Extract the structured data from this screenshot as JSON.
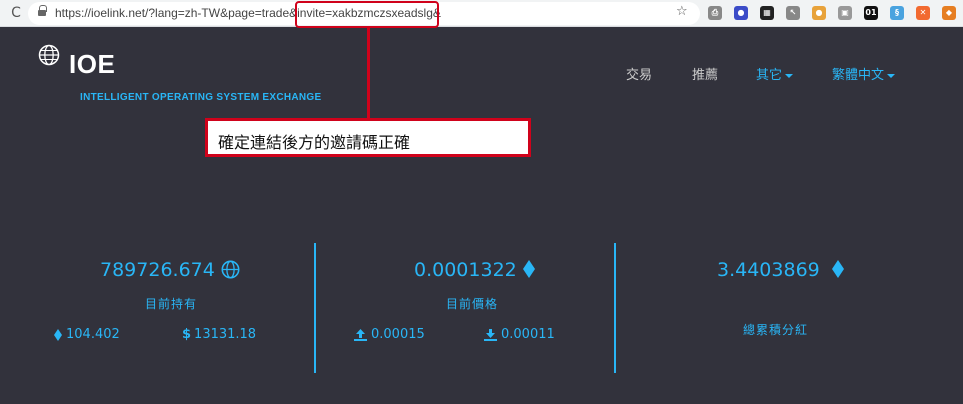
{
  "browser": {
    "url": "https://ioelink.net/?lang=zh-TW&page=trade&invite=xakbzmczsxeadslg&",
    "star_icon": "star-icon",
    "extensions": [
      {
        "name": "print-icon",
        "glyph": "⎙",
        "color": "#888"
      },
      {
        "name": "circle-logo-icon",
        "glyph": "●",
        "color": "#3c4cc8"
      },
      {
        "name": "qr-icon",
        "glyph": "▦",
        "color": "#222"
      },
      {
        "name": "cursor-icon",
        "glyph": "↖",
        "color": "#888"
      },
      {
        "name": "cookie-icon",
        "glyph": "●",
        "color": "#e8a23a"
      },
      {
        "name": "image-icon",
        "glyph": "▣",
        "color": "#999"
      },
      {
        "name": "binary-icon",
        "glyph": "01",
        "color": "#111"
      },
      {
        "name": "shield-blue-icon",
        "glyph": "§",
        "color": "#4aa3df"
      },
      {
        "name": "puzzle-orange-icon",
        "glyph": "✕",
        "color": "#f26a30"
      },
      {
        "name": "fox-icon",
        "glyph": "◆",
        "color": "#e67e22"
      }
    ]
  },
  "annotation": {
    "callout_text": "確定連結後方的邀請碼正確",
    "highlight_color": "#d0021b"
  },
  "header": {
    "logo_text": "IOE",
    "tagline": "INTELLIGENT OPERATING SYSTEM EXCHANGE",
    "nav": {
      "trade": "交易",
      "referral": "推薦",
      "other": "其它",
      "language": "繁體中文"
    }
  },
  "stats": {
    "holding": {
      "value": "789726.674",
      "label": "目前持有",
      "eth": "104.402",
      "usd": "13131.18"
    },
    "price": {
      "value": "0.0001322",
      "label": "目前價格",
      "up": "0.00015",
      "down": "0.00011"
    },
    "dividend": {
      "value": "3.4403869",
      "label": "總累積分紅"
    }
  },
  "colors": {
    "accent": "#29b6f6",
    "background": "#32323c"
  }
}
